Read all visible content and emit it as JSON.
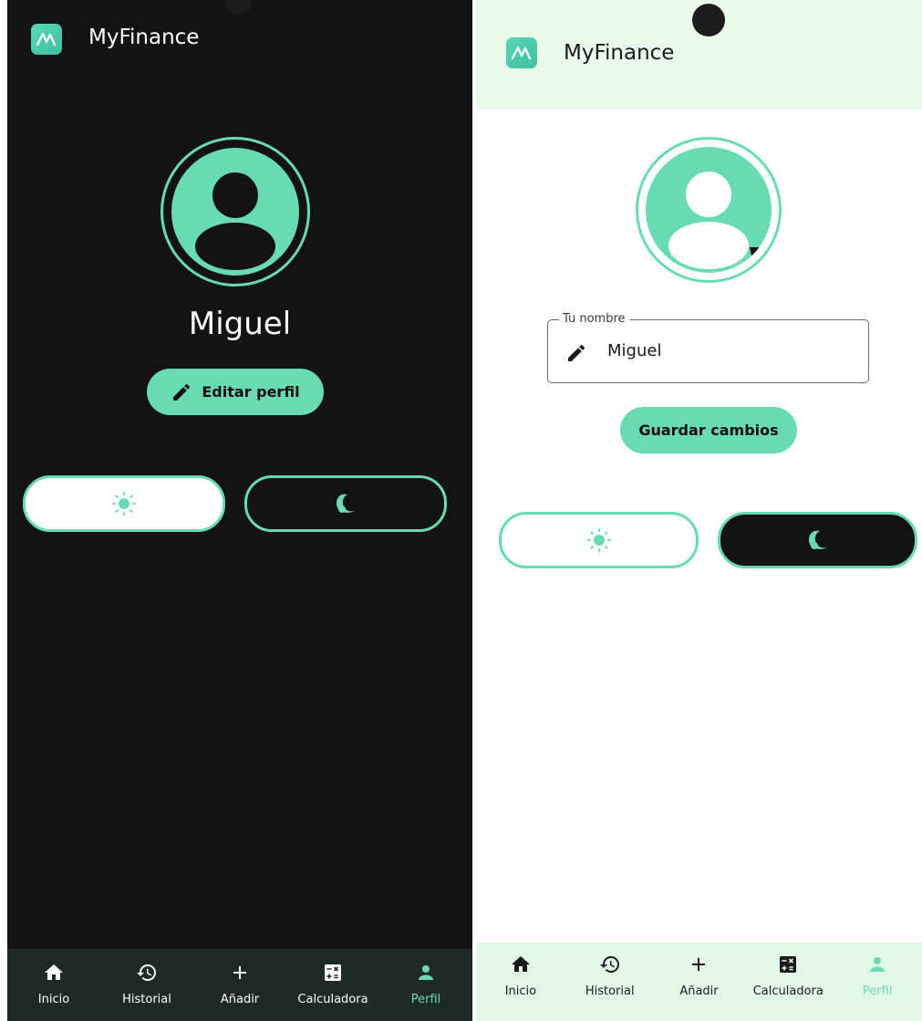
{
  "app": {
    "title": "MyFinance",
    "accent_color": "#69dbb3",
    "logo_icon": "logo-chart-icon"
  },
  "profile_view": {
    "username": "Miguel",
    "edit_button_label": "Editar perfil",
    "edit_icon": "pencil-icon",
    "theme_light_icon": "sun-icon",
    "theme_dark_icon": "moon-icon",
    "background_color": "#131313"
  },
  "profile_edit": {
    "name_field_label": "Tu nombre",
    "name_field_value": "Miguel",
    "name_field_icon": "pencil-icon",
    "save_button_label": "Guardar cambios",
    "theme_light_icon": "sun-icon",
    "theme_dark_icon": "moon-icon",
    "header_background_color": "#e9fbea"
  },
  "bottom_nav": {
    "items": [
      {
        "label": "Inicio",
        "icon": "home-icon"
      },
      {
        "label": "Historial",
        "icon": "history-icon"
      },
      {
        "label": "Añadir",
        "icon": "plus-icon"
      },
      {
        "label": "Calculadora",
        "icon": "calculator-icon"
      },
      {
        "label": "Perfil",
        "icon": "person-icon",
        "active": true
      }
    ]
  }
}
